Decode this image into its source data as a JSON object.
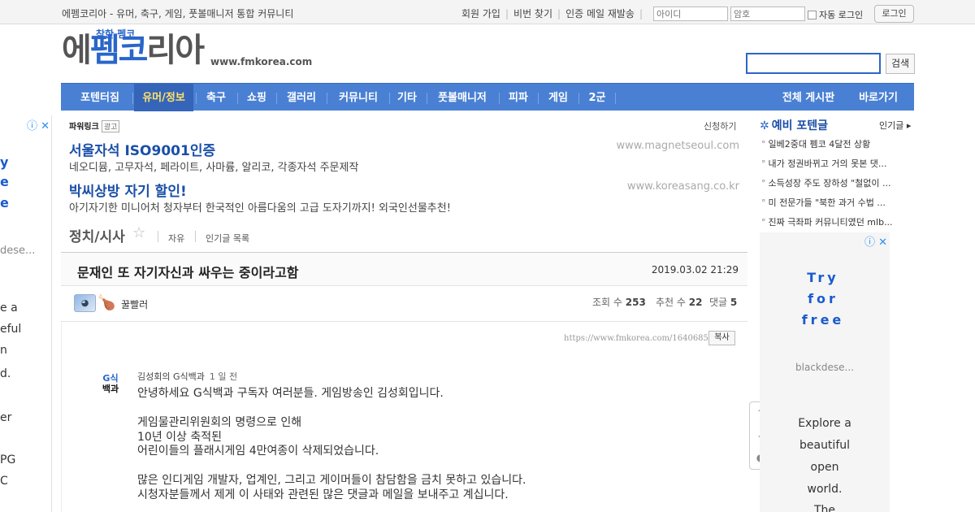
{
  "topbar": {
    "site_desc": "에펨코리아 - 유머, 축구, 게임, 풋볼매니저 통합 커뮤니티",
    "links": [
      "회원 가입",
      "비번 찾기",
      "인증 메일 재발송"
    ],
    "id_placeholder": "아이디",
    "pw_placeholder": "암호",
    "auto_login": "자동 로그인",
    "login": "로그인"
  },
  "header": {
    "logo_small": "착한 펨코",
    "logo_pre": "에",
    "logo_hl": "펨코",
    "logo_post": "리아",
    "logo_url": "www.fmkorea.com",
    "search_button": "검색"
  },
  "nav": {
    "items": [
      "포텐터짐",
      "유머/정보",
      "축구",
      "쇼핑",
      "갤러리",
      "커뮤니티",
      "기타",
      "풋볼매니저",
      "피파",
      "게임",
      "2군"
    ],
    "all_boards": "전체 게시판",
    "shortcut": "바로가기"
  },
  "left_ad": {
    "lines": [
      "y",
      "e",
      "e",
      "dese...",
      "e a",
      "eful",
      "n",
      "d.",
      "er",
      "PG",
      "C"
    ]
  },
  "powerlink": {
    "label": "파워링크",
    "badge": "광고",
    "apply": "신청하기",
    "ads": [
      {
        "title": "서울자석 ISO9001인증",
        "url": "www.magnetseoul.com",
        "desc": "네오디뮴, 고무자석, 페라이트, 사마륨, 알리코, 각종자석 주문제작"
      },
      {
        "title": "박씨상방 자기 할인!",
        "url": "www.koreasang.co.kr",
        "desc": "아기자기한 미니어처 청자부터 한국적인 아름다움의 고급 도자기까지! 외국인선물추천!"
      }
    ]
  },
  "board": {
    "name": "정치/시사",
    "links": [
      "자유",
      "인기글 목록"
    ]
  },
  "post": {
    "title": "문재인 또 자기자신과 싸우는 중이라고함",
    "date": "2019.03.02 21:29",
    "author": "꿀빨러",
    "views_label": "조회 수",
    "views": "253",
    "votes_label": "추천 수",
    "votes": "22",
    "comments_label": "댓글",
    "comments": "5",
    "short_url": "https://www.fmkorea.com/1640685863",
    "copy": "복사",
    "channel_logo_top": "G식",
    "channel_logo_bottom": "백과",
    "channel_name": "김성회의 G식백과",
    "channel_time": "1 일 전",
    "body": [
      "안녕하세요 G식백과 구독자 여러분들. 게임방송인 김성회입니다.",
      "게임물관리위원회의 명령으로 인해",
      "10년 이상 축적된",
      "어린이들의 플래시게임 4만여종이 삭제되었습니다.",
      "많은 인디게임 개발자, 업계인, 그리고 게이머들이 참담함을 금치 못하고 있습니다.",
      "시청자분들께서 제게 이 사태와 관련된 많은 댓글과 메일을 보내주고 계십니다."
    ]
  },
  "potential": {
    "title": "예비 포텐글",
    "more": "인기글",
    "items": [
      "일베2중대 펨코 4달전 상황",
      "내가 정권바뀌고 거의 못본 댓...",
      "소득성장 주도 장하성 \"철없이 ...",
      "미 전문가들 \"북한 과거 수법 ...",
      "진짜 극좌파 커뮤니티였던 mlb..."
    ]
  },
  "right_ad": {
    "try_lines": [
      "Try",
      "for",
      "free"
    ],
    "brand": "blackdese...",
    "copy_lines": [
      "Explore a",
      "beautiful",
      "open",
      "world.",
      "The"
    ]
  },
  "colors": {
    "nav_bg": "#4a80d4",
    "nav_active_text": "#ffe168",
    "brand_blue": "#2a66c9"
  }
}
